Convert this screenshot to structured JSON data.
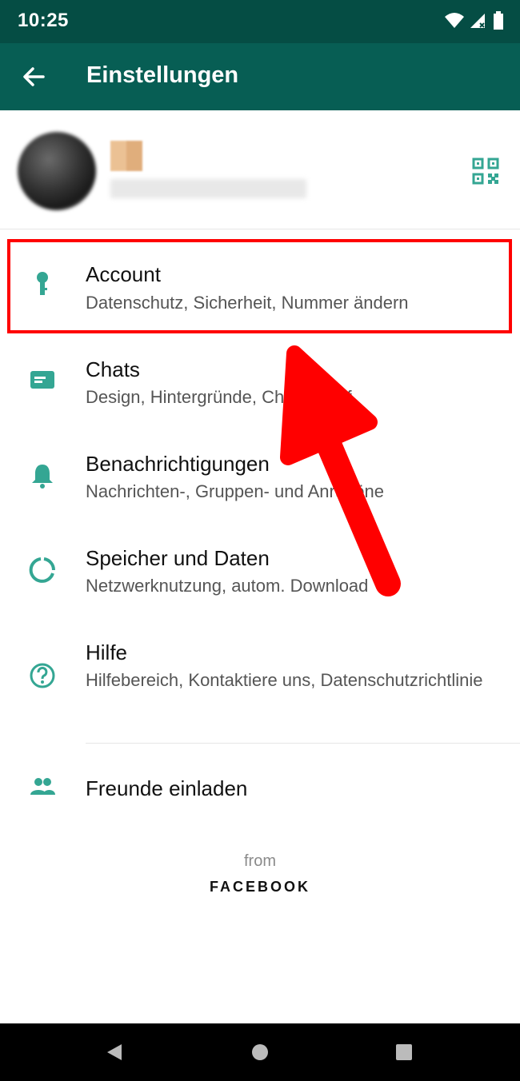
{
  "status_bar": {
    "time": "10:25"
  },
  "app_bar": {
    "title": "Einstellungen"
  },
  "settings": [
    {
      "label": "Account",
      "sub": "Datenschutz, Sicherheit, Nummer ändern"
    },
    {
      "label": "Chats",
      "sub": "Design, Hintergründe, Chatverlauf"
    },
    {
      "label": "Benachrichtigungen",
      "sub": "Nachrichten-, Gruppen- und Anruftöne"
    },
    {
      "label": "Speicher und Daten",
      "sub": "Netzwerknutzung, autom. Download"
    },
    {
      "label": "Hilfe",
      "sub": "Hilfebereich, Kontaktiere uns, Datenschutzrichtlinie"
    },
    {
      "label": "Freunde einladen"
    }
  ],
  "footer": {
    "from": "from",
    "brand": "FACEBOOK"
  },
  "colors": {
    "header": "#075e54",
    "status": "#054d44",
    "icon": "#34a693",
    "highlight": "#ff0000"
  }
}
